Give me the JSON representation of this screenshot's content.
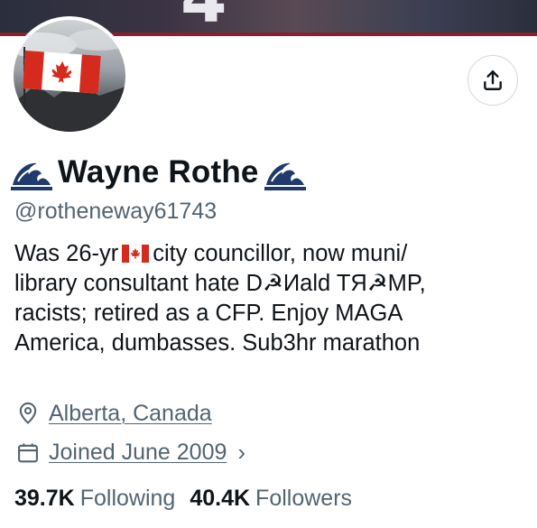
{
  "banner": {
    "text": "4"
  },
  "profile": {
    "name": "Wayne Rothe",
    "handle": "@rotheneway61743",
    "name_decoration_icon": "great-wave-emoji",
    "avatar_icon": "canada-flag-avatar"
  },
  "actions": {
    "share_icon": "share-icon"
  },
  "bio": {
    "line1_a": "Was 26-yr",
    "line1_icon": "canada-flag-emoji",
    "line1_b": "city councillor, now muni/",
    "line2": "library consultant hate D☭Иald TЯ☭MP,",
    "line3": "racists; retired as a CFP. Enjoy MAGA",
    "line4": "America, dumbasses. Sub3hr marathon"
  },
  "location": {
    "text": "Alberta, Canada",
    "icon": "location-pin-icon"
  },
  "joined": {
    "text": "Joined June 2009",
    "icon": "calendar-icon",
    "chevron": "›"
  },
  "stats": {
    "following_count": "39.7K",
    "following_label": "Following",
    "followers_count": "40.4K",
    "followers_label": "Followers"
  },
  "colors": {
    "text": "#0f1419",
    "secondary": "#536471",
    "border": "#cfd9de",
    "flag_red": "#d52b1e"
  }
}
